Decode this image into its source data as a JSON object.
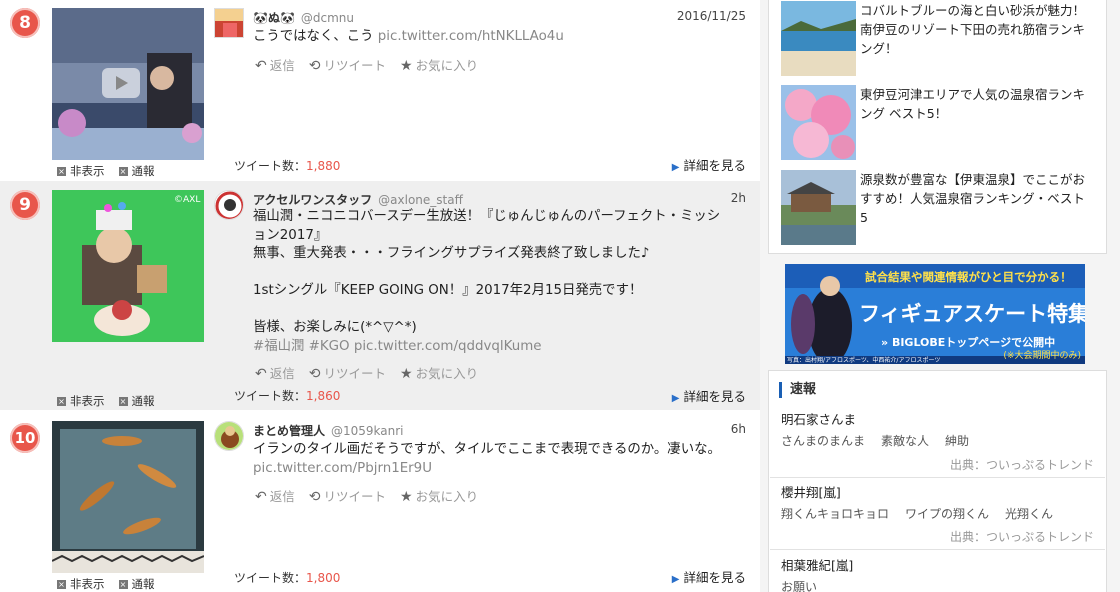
{
  "tweets": [
    {
      "rank": "8",
      "handle": "@dcmnu",
      "name": "🐼ぬ🐼",
      "time": "2016/11/25",
      "text": "こうではなく、こう",
      "link": "pic.twitter.com/htNKLLAo4u",
      "reply": "返信",
      "retweet": "リツイート",
      "fav": "お気に入り",
      "count_label": "ツイート数：",
      "count": "1,880",
      "more": "詳細を見る",
      "hide": "非表示",
      "report": "通報"
    },
    {
      "rank": "9",
      "handle": "@axlone_staff",
      "name": "アクセルワンスタッフ",
      "time": "2h",
      "text_lines": [
        "福山潤・ニコニコバースデー生放送！『じゅんじゅんのパーフェクト・ミッシ",
        "ョン2017』",
        "無事、重大発表・・・フライングサプライズ発表終了致しました♪",
        "",
        "1stシングル『KEEP GOING ON！』2017年2月15日発売です！",
        "",
        "皆様、お楽しみに(*^▽^*)"
      ],
      "link": "#福山潤 #KGO pic.twitter.com/qddvqlKume",
      "reply": "返信",
      "retweet": "リツイート",
      "fav": "お気に入り",
      "count_label": "ツイート数：",
      "count": "1,860",
      "more": "詳細を見る",
      "hide": "非表示",
      "report": "通報",
      "thumb_mark": "©AXL"
    },
    {
      "rank": "10",
      "handle": "@1059kanri",
      "name": "まとめ管理人",
      "time": "6h",
      "text": "イランのタイル画だそうですが、タイルでここまで表現できるのか。凄いな。",
      "link": "pic.twitter.com/Pbjrn1Er9U",
      "reply": "返信",
      "retweet": "リツイート",
      "fav": "お気に入り",
      "count_label": "ツイート数：",
      "count": "1,800",
      "more": "詳細を見る",
      "hide": "非表示",
      "report": "通報"
    }
  ],
  "ranking": [
    {
      "text": "コバルトブルーの海と白い砂浜が魅力！南伊豆のリゾート下田の売れ筋宿ランキング！"
    },
    {
      "text": "東伊豆河津エリアで人気の温泉宿ランキング ベスト5！"
    },
    {
      "text": "源泉数が豊富な【伊東温泉】でここがおすすめ！人気温泉宿ランキング・ベスト5"
    }
  ],
  "banner": {
    "top": "試合結果や関連情報がひと目で分かる！",
    "main": "フィギュアスケート特集",
    "sub": "BIGLOBEトップページで公開中",
    "note": "(※大会期間中のみ)",
    "credit": "写真：出村翔/アフロスポーツ、中西祐介/アフロスポーツ"
  },
  "news": {
    "heading": "速報",
    "items": [
      {
        "title": "明石家さんま",
        "tags": [
          "さんまのまんま",
          "素敵な人",
          "紳助"
        ],
        "source": "出典：ついっぷるトレンド"
      },
      {
        "title": "櫻井翔[嵐]",
        "tags": [
          "翔くんキョロキョロ",
          "ワイプの翔くん",
          "光翔くん"
        ],
        "source": "出典：ついっぷるトレンド"
      },
      {
        "title": "相葉雅紀[嵐]",
        "tags": [
          "お願い"
        ],
        "source": ""
      }
    ]
  },
  "colors": {
    "accent": "#e8564b",
    "link": "#2a6fc9",
    "news_bar": "#1a5fb4"
  }
}
